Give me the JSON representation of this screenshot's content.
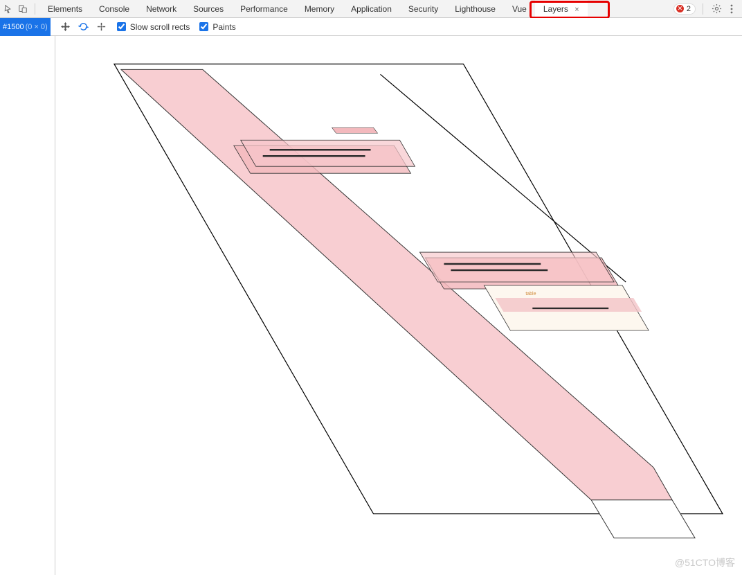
{
  "tabs": {
    "list": [
      {
        "label": "Elements"
      },
      {
        "label": "Console"
      },
      {
        "label": "Network"
      },
      {
        "label": "Sources"
      },
      {
        "label": "Performance"
      },
      {
        "label": "Memory"
      },
      {
        "label": "Application"
      },
      {
        "label": "Security"
      },
      {
        "label": "Lighthouse"
      },
      {
        "label": "Vue"
      },
      {
        "label": "Layers",
        "active": true,
        "closable": true
      }
    ],
    "close_glyph": "×"
  },
  "status": {
    "error_count": "2",
    "error_glyph": "⊘"
  },
  "sidebar": {
    "node_id": "#1500",
    "node_dim": "(0 × 0)"
  },
  "toolbar": {
    "checkbox_slow_scroll": "Slow scroll rects",
    "checkbox_paints": "Paints"
  },
  "watermark": "@51CTO博客"
}
